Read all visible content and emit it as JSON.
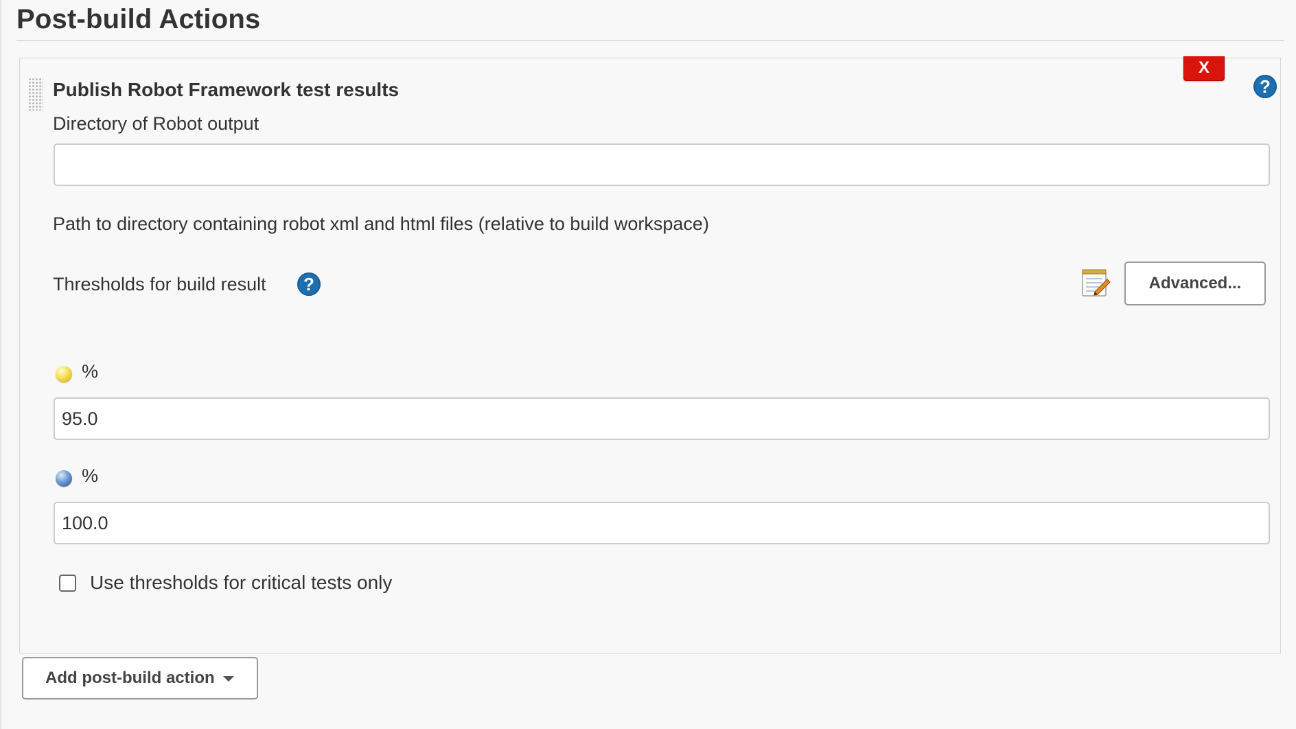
{
  "section": {
    "title": "Post-build Actions"
  },
  "robot_publisher": {
    "title": "Publish Robot Framework test results",
    "delete_label": "X",
    "help_label": "?",
    "output_directory": {
      "label": "Directory of Robot output",
      "value": "",
      "help_text": "Path to directory containing robot xml and html files (relative to build workspace)"
    },
    "advanced_label": "Advanced...",
    "thresholds": {
      "label": "Thresholds for build result",
      "help_label": "?",
      "unstable": {
        "ball_color": "yellow",
        "label": "%",
        "value": "95.0"
      },
      "pass": {
        "ball_color": "blue",
        "label": "%",
        "value": "100.0"
      },
      "critical_only": {
        "label": "Use thresholds for critical tests only",
        "checked": false
      }
    }
  },
  "add_action": {
    "label": "Add post-build action"
  },
  "colors": {
    "delete_red": "#d9140c",
    "help_blue": "#1d6fb0",
    "text": "#333333",
    "background": "#f8f8f8"
  }
}
